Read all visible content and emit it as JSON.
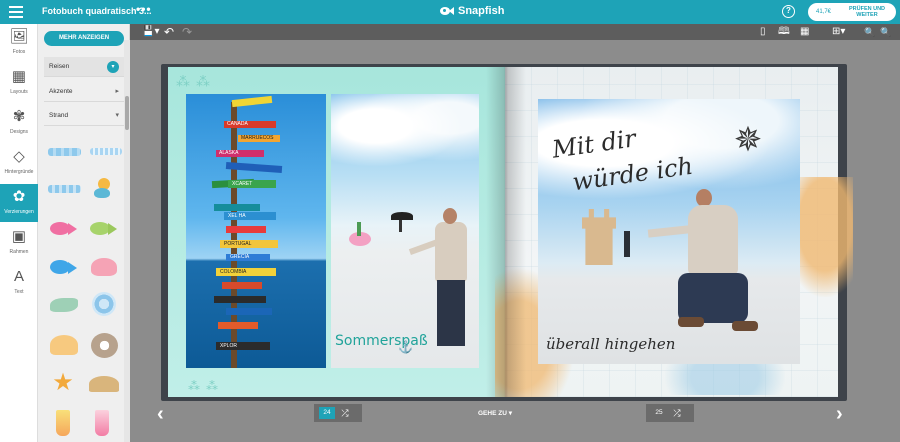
{
  "header": {
    "title": "Fotobuch quadratisch 3...",
    "more": "•••",
    "brand": "Snapfish",
    "help": "?",
    "price": "41,7€",
    "checkout_line1": "PRÜFEN UND",
    "checkout_line2": "WEITER"
  },
  "toolbar": {
    "save": "💾▾",
    "undo": "↶",
    "redo": "↷",
    "view_single": "▯",
    "view_spread": "🕮",
    "view_grid": "▦",
    "layout_menu": "⊞▾",
    "zoom_in": "🔍",
    "zoom_out": "🔍"
  },
  "rail": [
    {
      "label": "Fotos",
      "icon": "🖼"
    },
    {
      "label": "Layouts",
      "icon": "▦"
    },
    {
      "label": "Designs",
      "icon": "✾"
    },
    {
      "label": "Hintergründe",
      "icon": "◇"
    },
    {
      "label": "Verzierungen",
      "icon": "✿"
    },
    {
      "label": "Rahmen",
      "icon": "▣"
    },
    {
      "label": "Text",
      "icon": "A"
    }
  ],
  "panel": {
    "show_more": "MEHR ANZEIGEN",
    "category": "Reisen",
    "sub1": "Akzente",
    "sub2": "Strand"
  },
  "stickers": [
    {
      "name": "wave-border-icon",
      "glyph": "〰"
    },
    {
      "name": "lace-border-icon",
      "glyph": "⁓"
    },
    {
      "name": "sand-border-icon",
      "glyph": "〰"
    },
    {
      "name": "mermaid-icon",
      "glyph": "🧜"
    },
    {
      "name": "pink-fish-icon",
      "glyph": "🐟"
    },
    {
      "name": "green-fish-icon",
      "glyph": "🐠"
    },
    {
      "name": "blue-fish-icon",
      "glyph": "🐟"
    },
    {
      "name": "pink-shell-icon",
      "glyph": "🐚"
    },
    {
      "name": "conch-icon",
      "glyph": "🐚"
    },
    {
      "name": "spiral-shell-icon",
      "glyph": "🌀"
    },
    {
      "name": "scallop-shell-icon",
      "glyph": "🐚"
    },
    {
      "name": "oyster-icon",
      "glyph": "🦪"
    },
    {
      "name": "starfish-icon",
      "glyph": "⭐"
    },
    {
      "name": "sand-pile-icon",
      "glyph": "⛰"
    },
    {
      "name": "cocktail-icon",
      "glyph": "🍹"
    },
    {
      "name": "drink-icon",
      "glyph": "🍹"
    }
  ],
  "spread": {
    "left_caption": "Sommerspaß",
    "right_line1": "Mit dir",
    "right_line2": "würde ich",
    "right_line3": "überall hingehen",
    "signpost_labels": [
      "CANADA",
      "MARRUECOS",
      "ALASKA",
      "XCARET",
      "XEL HA",
      "PORTUGAL",
      "GRECIA",
      "COLOMBIA",
      "XPLOR"
    ]
  },
  "footer": {
    "prev": "‹",
    "next": "›",
    "page_left": "24",
    "page_right": "25",
    "shuffle": "⤮",
    "goto": "GEHE ZU ▾"
  },
  "colors": {
    "accent": "#1ea3b7",
    "toolbar": "#5d5d5d",
    "stage": "#8c8c8c"
  }
}
